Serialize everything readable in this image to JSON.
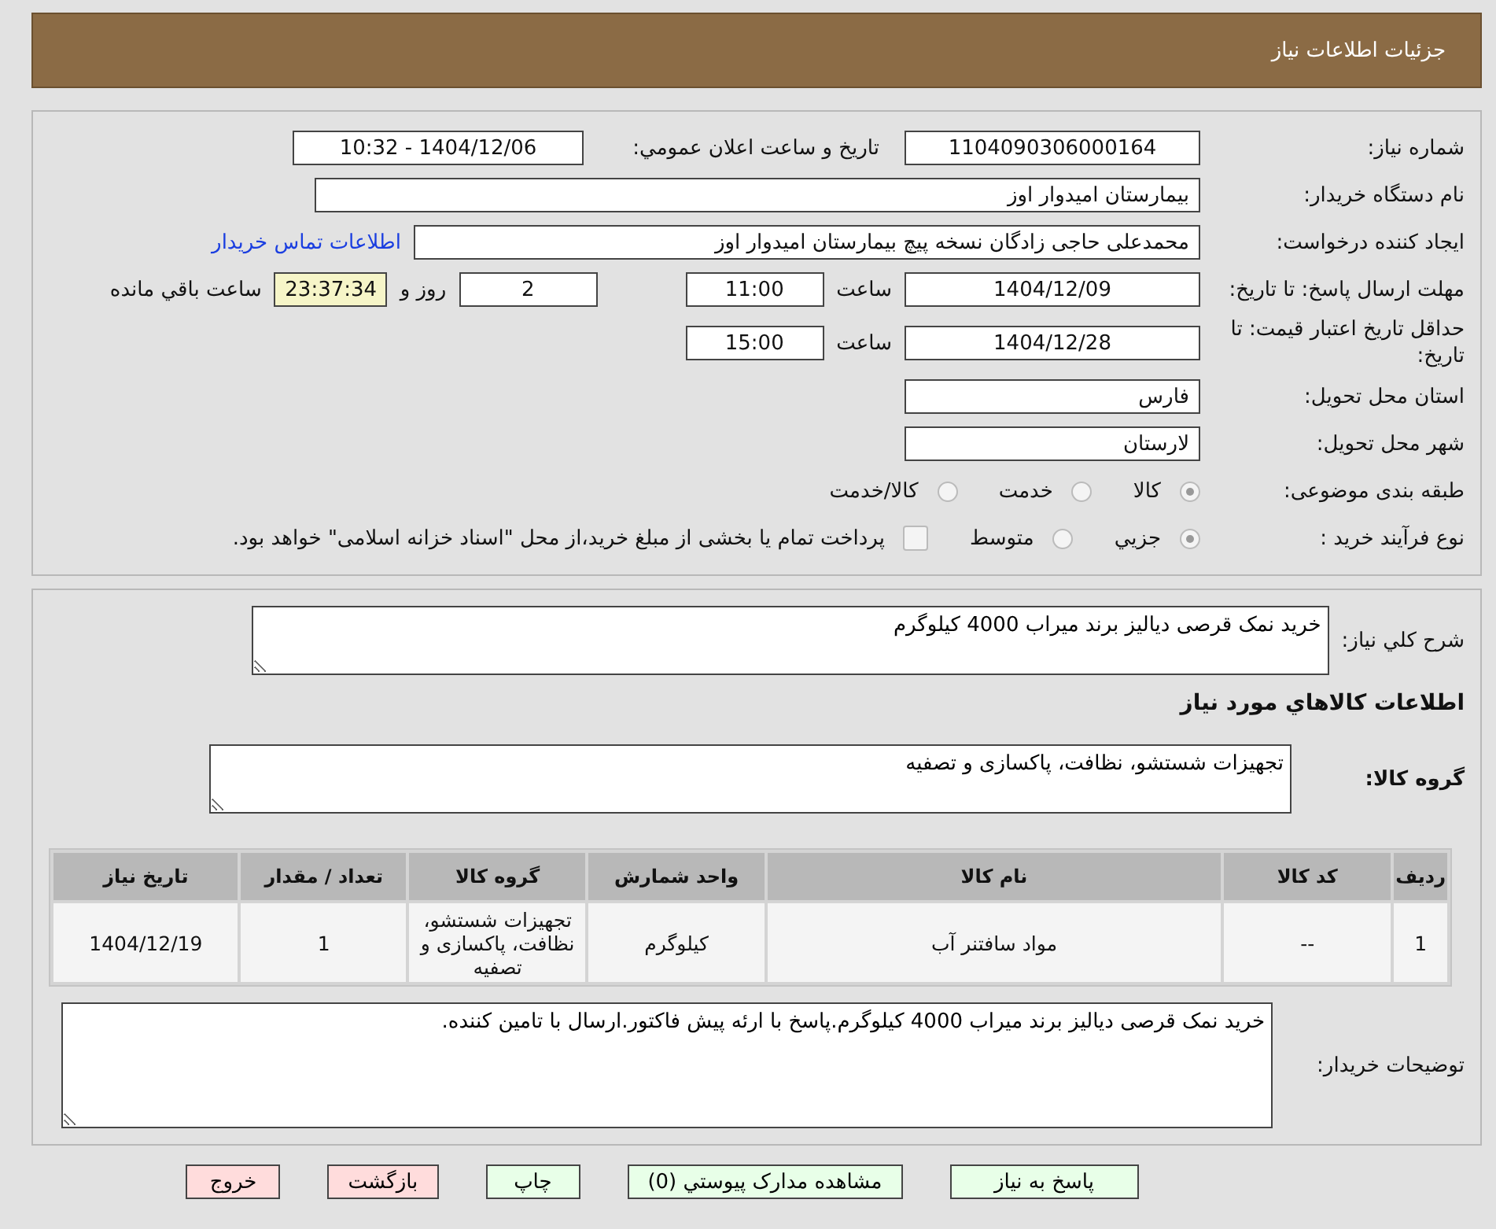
{
  "header": {
    "title": "جزئيات اطلاعات نياز"
  },
  "need_number": {
    "label": "شماره نياز:",
    "value": "1104090306000164"
  },
  "announce": {
    "label": "تاريخ و ساعت اعلان عمومي:",
    "value": "1404/12/06 - 10:32"
  },
  "buyer_org": {
    "label": "نام دستگاه خريدار:",
    "value": "بيمارستان  اميدوار اوز"
  },
  "requester": {
    "label": "ايجاد کننده درخواست:",
    "value": "محمدعلی حاجی زادگان نسخه پیچ بیمارستان  امیدوار اوز",
    "link": "اطلاعات تماس خريدار"
  },
  "deadline": {
    "label": "مهلت ارسال پاسخ: تا تاريخ:",
    "date": "1404/12/09",
    "time_label": "ساعت",
    "time": "11:00",
    "days": "2",
    "days_label": "روز و",
    "remaining": "23:37:34",
    "remaining_label": "ساعت باقي مانده"
  },
  "validity": {
    "label": "حداقل تاريخ اعتبار قيمت: تا تاريخ:",
    "date": "1404/12/28",
    "time_label": "ساعت",
    "time": "15:00"
  },
  "province": {
    "label": "استان محل تحويل:",
    "value": "فارس"
  },
  "city": {
    "label": "شهر محل تحويل:",
    "value": "لارستان"
  },
  "category": {
    "label": "طبقه بندی موضوعی:",
    "options": [
      {
        "label": "کالا",
        "selected": true
      },
      {
        "label": "خدمت",
        "selected": false
      },
      {
        "label": "کالا/خدمت",
        "selected": false
      }
    ]
  },
  "process": {
    "label": "نوع فرآیند خرید :",
    "options": [
      {
        "label": "جزيي",
        "selected": true
      },
      {
        "label": "متوسط",
        "selected": false
      }
    ],
    "payment": {
      "label": "پرداخت تمام یا بخشی از مبلغ خرید،از محل \"اسناد خزانه اسلامی\" خواهد بود.",
      "checked": false
    }
  },
  "summary": {
    "label": "شرح کلي نياز:",
    "value": "خريد نمک قرصی دياليز برند ميراب 4000 کيلوگرم"
  },
  "goods_title": "اطلاعات کالاهاي مورد نياز",
  "goods_group": {
    "label": "گروه کالا:",
    "value": "تجهيزات شستشو، نظافت، پاکسازی و تصفيه"
  },
  "table": {
    "columns": [
      "رديف",
      "کد کالا",
      "نام کالا",
      "واحد شمارش",
      "گروه کالا",
      "تعداد / مقدار",
      "تاريخ نياز"
    ],
    "rows": [
      [
        "1",
        "--",
        "مواد سافتنر آب",
        "کيلوگرم",
        "تجهيزات شستشو، نظافت، پاکسازی و تصفيه",
        "1",
        "1404/12/19"
      ]
    ]
  },
  "buyer_notes": {
    "label": "توضيحات خريدار:",
    "value": "خريد نمک قرصی دياليز برند ميراب 4000 کيلوگرم.پاسخ با ارئه پيش فاکتور.ارسال با تامين کننده."
  },
  "buttons": [
    {
      "label": "پاسخ به نياز",
      "kind": "go"
    },
    {
      "label": "مشاهده مدارک پيوستي (0)",
      "kind": "go"
    },
    {
      "label": "چاپ",
      "kind": "go"
    },
    {
      "label": "بازگشت",
      "kind": "stop"
    },
    {
      "label": "خروج",
      "kind": "stop"
    }
  ]
}
